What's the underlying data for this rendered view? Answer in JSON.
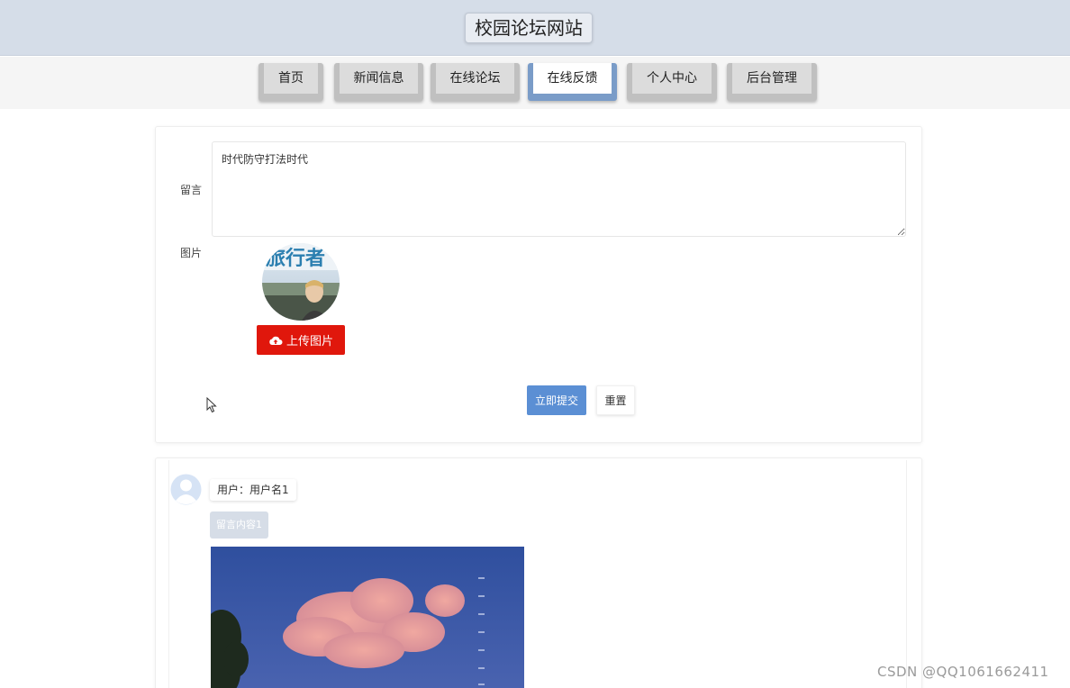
{
  "header": {
    "title": "校园论坛网站"
  },
  "nav": {
    "tabs": [
      {
        "label": "首页",
        "active": false
      },
      {
        "label": "新闻信息",
        "active": false
      },
      {
        "label": "在线论坛",
        "active": false
      },
      {
        "label": "在线反馈",
        "active": true
      },
      {
        "label": "个人中心",
        "active": false
      },
      {
        "label": "后台管理",
        "active": false
      }
    ]
  },
  "form": {
    "message_label": "留言",
    "message_value": "时代防守打法时代",
    "image_label": "图片",
    "upload_label": "上传图片",
    "submit_label": "立即提交",
    "reset_label": "重置"
  },
  "comment": {
    "user_text": "用户：用户名1",
    "content_text": "留言内容1"
  },
  "preview_logo_text": "旅行者",
  "watermark": "CSDN @QQ1061662411",
  "colors": {
    "header_bg": "#d5dde8",
    "active_tab_accent": "#7a9cc8",
    "upload_button": "#e0170c",
    "submit_button": "#5b8fd4"
  },
  "icons": {
    "upload": "cloud-upload-icon",
    "avatar": "user-avatar-icon",
    "cursor": "mouse-pointer-icon"
  }
}
